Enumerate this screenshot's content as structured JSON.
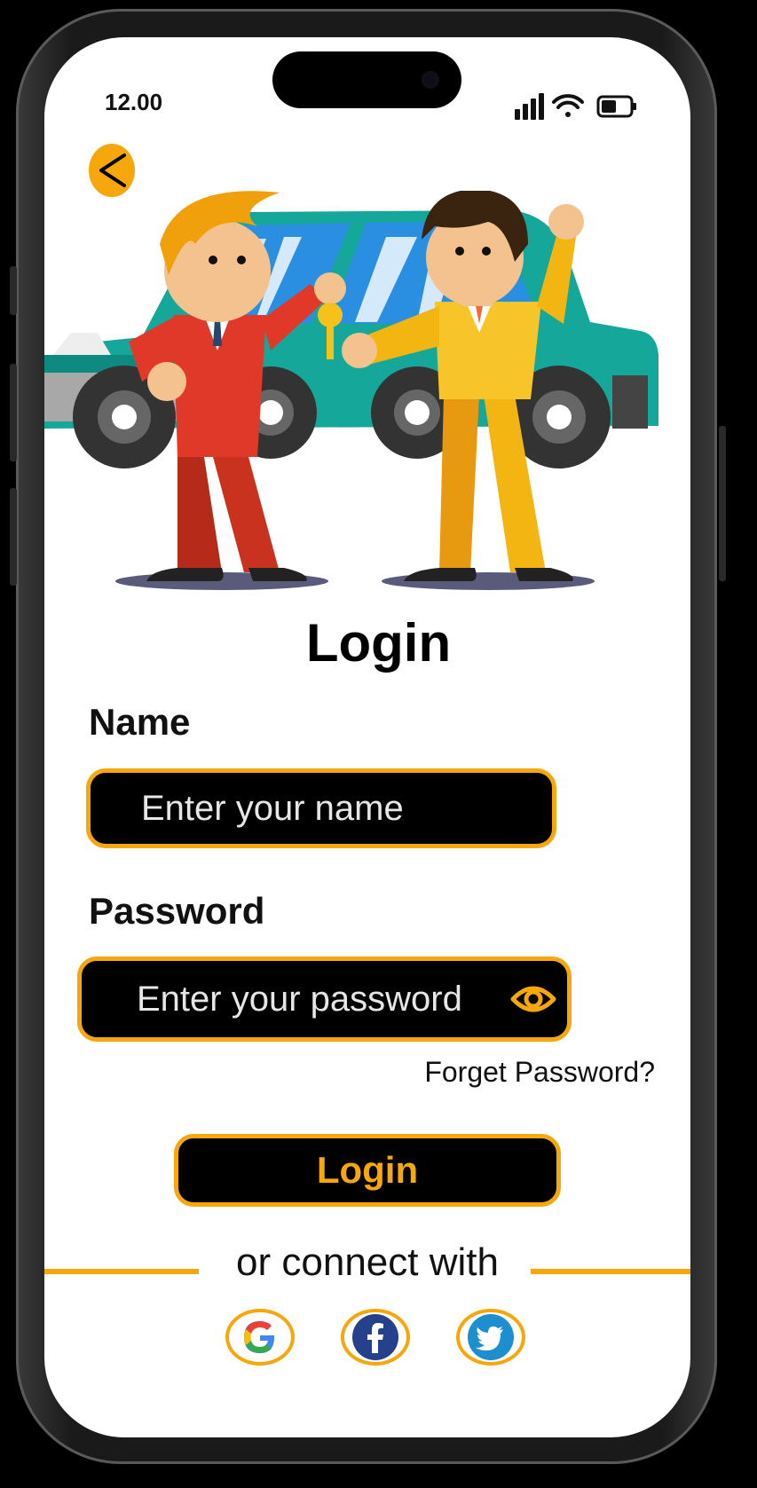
{
  "status_bar": {
    "time": "12.00",
    "icons": [
      "signal-icon",
      "wifi-icon",
      "battery-icon"
    ]
  },
  "nav": {
    "back_icon": "chevron-left-icon"
  },
  "login": {
    "title": "Login",
    "name_label": "Name",
    "name_placeholder": "Enter your name",
    "password_label": "Password",
    "password_placeholder": "Enter your password",
    "forget_password": "Forget Password?",
    "submit_label": "Login"
  },
  "social": {
    "connect_text": "or connect with",
    "providers": [
      "google-icon",
      "facebook-icon",
      "twitter-icon"
    ]
  },
  "colors": {
    "accent": "#f5a70c",
    "field_bg": "#000000",
    "text": "#111111"
  }
}
